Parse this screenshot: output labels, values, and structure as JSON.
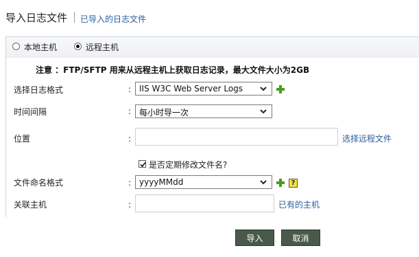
{
  "header": {
    "title": "导入日志文件",
    "imported_link": "已导入的日志文件"
  },
  "source": {
    "options": [
      {
        "label": "本地主机",
        "selected": false
      },
      {
        "label": "远程主机",
        "selected": true
      }
    ]
  },
  "notice": "注意 ：FTP/SFTP 用来从远程主机上获取日志记录，最大文件大小为2GB",
  "form": {
    "log_format": {
      "label": "选择日志格式",
      "value": "IIS W3C Web Server Logs"
    },
    "interval": {
      "label": "时间间隔",
      "value": "每小时导一次"
    },
    "location": {
      "label": "位置",
      "value": "",
      "link": "选择远程文件"
    },
    "rename_checkbox": {
      "label": "是否定期修改文件名?",
      "checked": true
    },
    "filename_format": {
      "label": "文件命名格式",
      "value": "yyyyMMdd"
    },
    "host": {
      "label": "关联主机",
      "value": "",
      "link": "已有的主机"
    },
    "colon": ":"
  },
  "buttons": {
    "import": "导入",
    "cancel": "取消"
  },
  "colors": {
    "link": "#2b5d9c",
    "plus": "#4c9a1e",
    "button_bg": "#4a5a4a"
  },
  "icons": [
    "add-icon",
    "help-icon",
    "dropdown-arrow-icon",
    "check-icon"
  ]
}
